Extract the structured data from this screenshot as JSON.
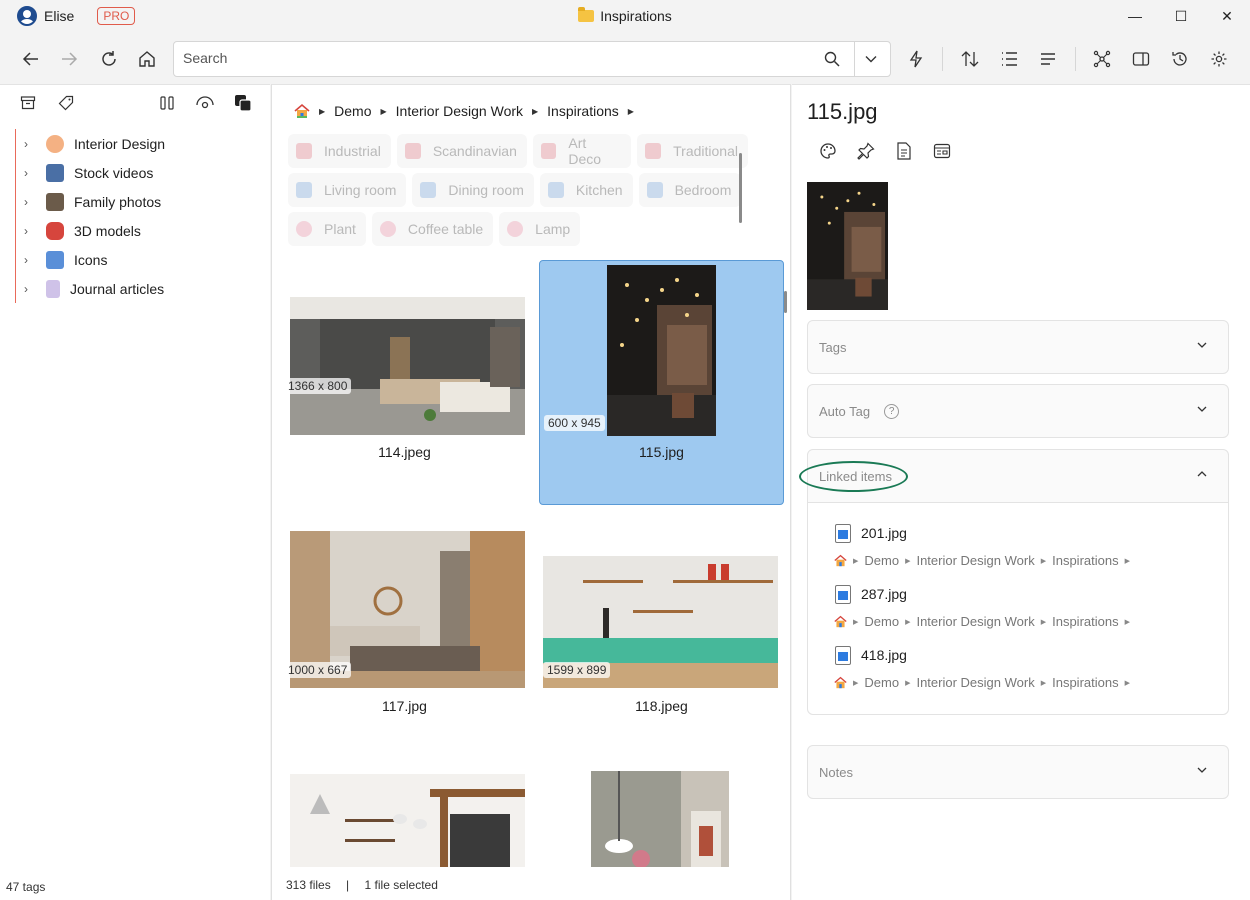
{
  "titlebar": {
    "user_name": "Elise",
    "badge": "PRO",
    "window_title": "Inspirations",
    "minimize": "—",
    "maximize": "☐",
    "close": "✕"
  },
  "toolbar": {
    "back": "←",
    "forward": "→",
    "refresh": "↻",
    "search_placeholder": "Search"
  },
  "sidebar": {
    "items": [
      {
        "label": "Interior Design",
        "icon": "palette-icon",
        "color": "#f08a5d"
      },
      {
        "label": "Stock videos",
        "icon": "film-icon",
        "color": "#4a6fa5"
      },
      {
        "label": "Family photos",
        "icon": "camera-icon",
        "color": "#6b5b4a"
      },
      {
        "label": "3D models",
        "icon": "car-icon",
        "color": "#d6453d"
      },
      {
        "label": "Icons",
        "icon": "symbols-icon",
        "color": "#5a8fd8"
      },
      {
        "label": "Journal articles",
        "icon": "document-icon",
        "color": "#b8a6d9"
      }
    ],
    "tags_count": "47 tags"
  },
  "main": {
    "breadcrumb": [
      "Demo",
      "Interior Design Work",
      "Inspirations"
    ],
    "chips": [
      [
        {
          "label": "Industrial",
          "color": "#e8a0a8"
        },
        {
          "label": "Scandinavian",
          "color": "#e8a0a8"
        },
        {
          "label": "Art Deco",
          "color": "#e8a0a8"
        },
        {
          "label": "Traditional",
          "color": "#e8a0a8"
        }
      ],
      [
        {
          "label": "Living room",
          "color": "#9dbde3"
        },
        {
          "label": "Dining room",
          "color": "#9dbde3"
        },
        {
          "label": "Kitchen",
          "color": "#9dbde3"
        },
        {
          "label": "Bedroom",
          "color": "#9dbde3"
        }
      ],
      [
        {
          "label": "Plant",
          "color": "#f0b0c0"
        },
        {
          "label": "Coffee table",
          "color": "#f0b0c0"
        },
        {
          "label": "Lamp",
          "color": "#f0b0c0"
        }
      ]
    ],
    "files": [
      {
        "name": "114.jpeg",
        "dims": "1366 x 800"
      },
      {
        "name": "115.jpg",
        "dims": "600 x 945"
      },
      {
        "name": "117.jpg",
        "dims": "1000 x 667"
      },
      {
        "name": "118.jpeg",
        "dims": "1599 x 899"
      },
      {
        "name": "",
        "dims": ""
      },
      {
        "name": "",
        "dims": ""
      }
    ],
    "status_files": "313 files",
    "status_sep": "|",
    "status_selected": "1 file selected"
  },
  "inspector": {
    "title": "115.jpg",
    "tags_label": "Tags",
    "autotag_label": "Auto Tag",
    "help": "?",
    "linked_label": "Linked items",
    "notes_label": "Notes",
    "linked_items": [
      {
        "name": "201.jpg",
        "path": [
          "Demo",
          "Interior Design Work",
          "Inspirations"
        ]
      },
      {
        "name": "287.jpg",
        "path": [
          "Demo",
          "Interior Design Work",
          "Inspirations"
        ]
      },
      {
        "name": "418.jpg",
        "path": [
          "Demo",
          "Interior Design Work",
          "Inspirations"
        ]
      }
    ]
  },
  "colors": {
    "selection": "#9ec9f0",
    "accent_pro": "#e05b4b",
    "annotation_ring": "#1a7a55"
  }
}
